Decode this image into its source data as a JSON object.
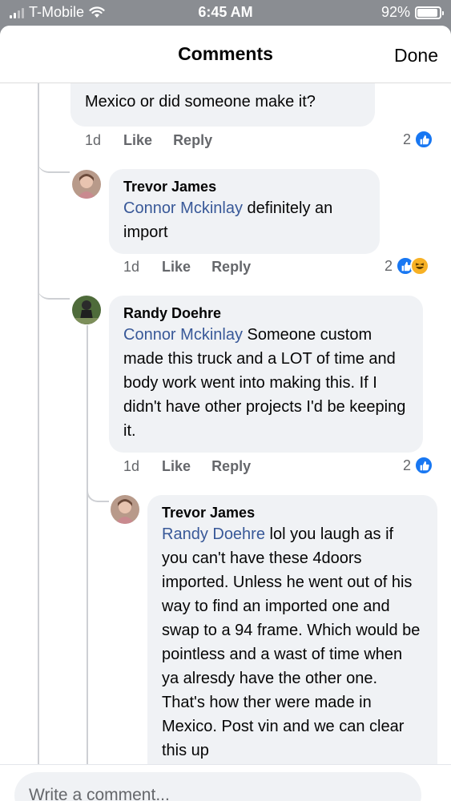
{
  "status": {
    "carrier": "T-Mobile",
    "time": "6:45 AM",
    "battery": "92%"
  },
  "header": {
    "title": "Comments",
    "done": "Done"
  },
  "top_comment": {
    "partial_text": "Mexico or did someone make it?",
    "time": "1d",
    "like": "Like",
    "reply": "Reply",
    "reactions": "2"
  },
  "comments": [
    {
      "name": "Trevor James",
      "mention": "Connor Mckinlay",
      "text": " definitely an import",
      "time": "1d",
      "like": "Like",
      "reply": "Reply",
      "reactions": "2"
    },
    {
      "name": "Randy Doehre",
      "mention": "Connor Mckinlay",
      "text": " Someone custom made this truck and a LOT of time and body work went into making this. If I didn't have other projects I'd be keeping it.",
      "time": "1d",
      "like": "Like",
      "reply": "Reply",
      "reactions": "2"
    },
    {
      "name": "Trevor James",
      "mention": "Randy Doehre",
      "text": " lol you laugh as if you can't have these 4doors imported. Unless he went out of his way to find an imported one and swap to a 94 frame. Which would be pointless and a wast of time when ya alresdy have the other one. That's how ther were made in Mexico. Post vin and we can clear this up"
    }
  ],
  "composer": {
    "placeholder": "Write a comment..."
  },
  "colors": {
    "accent": "#1877f2",
    "mention": "#385898",
    "bubble": "#f0f2f5"
  }
}
